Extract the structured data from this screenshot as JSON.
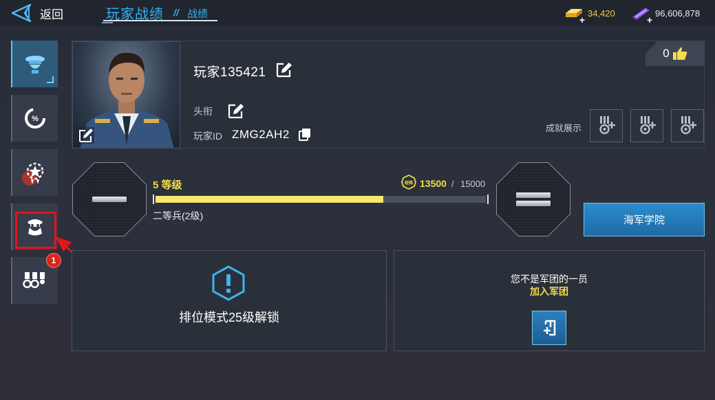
{
  "header": {
    "back_label": "返回",
    "title_main": "玩家战绩",
    "title_separator": "//",
    "title_sub": "战绩",
    "currencies": [
      {
        "name": "gold",
        "icon": "gold-bar-icon",
        "value": "34,420",
        "color": "#f2cf4a"
      },
      {
        "name": "credits",
        "icon": "purple-ticket-icon",
        "value": "96,606,878",
        "color": "#e8ecf2"
      }
    ]
  },
  "sidebar": {
    "items": [
      {
        "name": "profile",
        "icon": "officer-cap-icon",
        "active": true
      },
      {
        "name": "stats",
        "icon": "percent-gauge-icon",
        "active": false
      },
      {
        "name": "honors",
        "icon": "star-wreath-icon",
        "active": false
      },
      {
        "name": "crew",
        "icon": "pilot-helmet-icon",
        "active": false
      },
      {
        "name": "medals",
        "icon": "medals-icon",
        "active": false,
        "badge": "1"
      }
    ]
  },
  "profile": {
    "player_name": "玩家135421",
    "title_label": "头衔",
    "id_label": "玩家ID",
    "id_value": "ZMG2AH2",
    "likes": "0",
    "achievements_label": "成就展示"
  },
  "level": {
    "level_label": "5 等级",
    "xp_current": "13500",
    "xp_separator": "/",
    "xp_max": "15000",
    "xp_progress": 0.69,
    "rank_name": "二等兵(2级)",
    "xp_icon_text": "经验"
  },
  "academy": {
    "label": "海军学院"
  },
  "ranked": {
    "text": "排位模式25级解锁"
  },
  "legion": {
    "status": "您不是军团的一员",
    "join": "加入军团"
  },
  "colors": {
    "accent_blue": "#34b3f4",
    "yellow": "#f2de4e",
    "alert_red": "#e3141c"
  }
}
